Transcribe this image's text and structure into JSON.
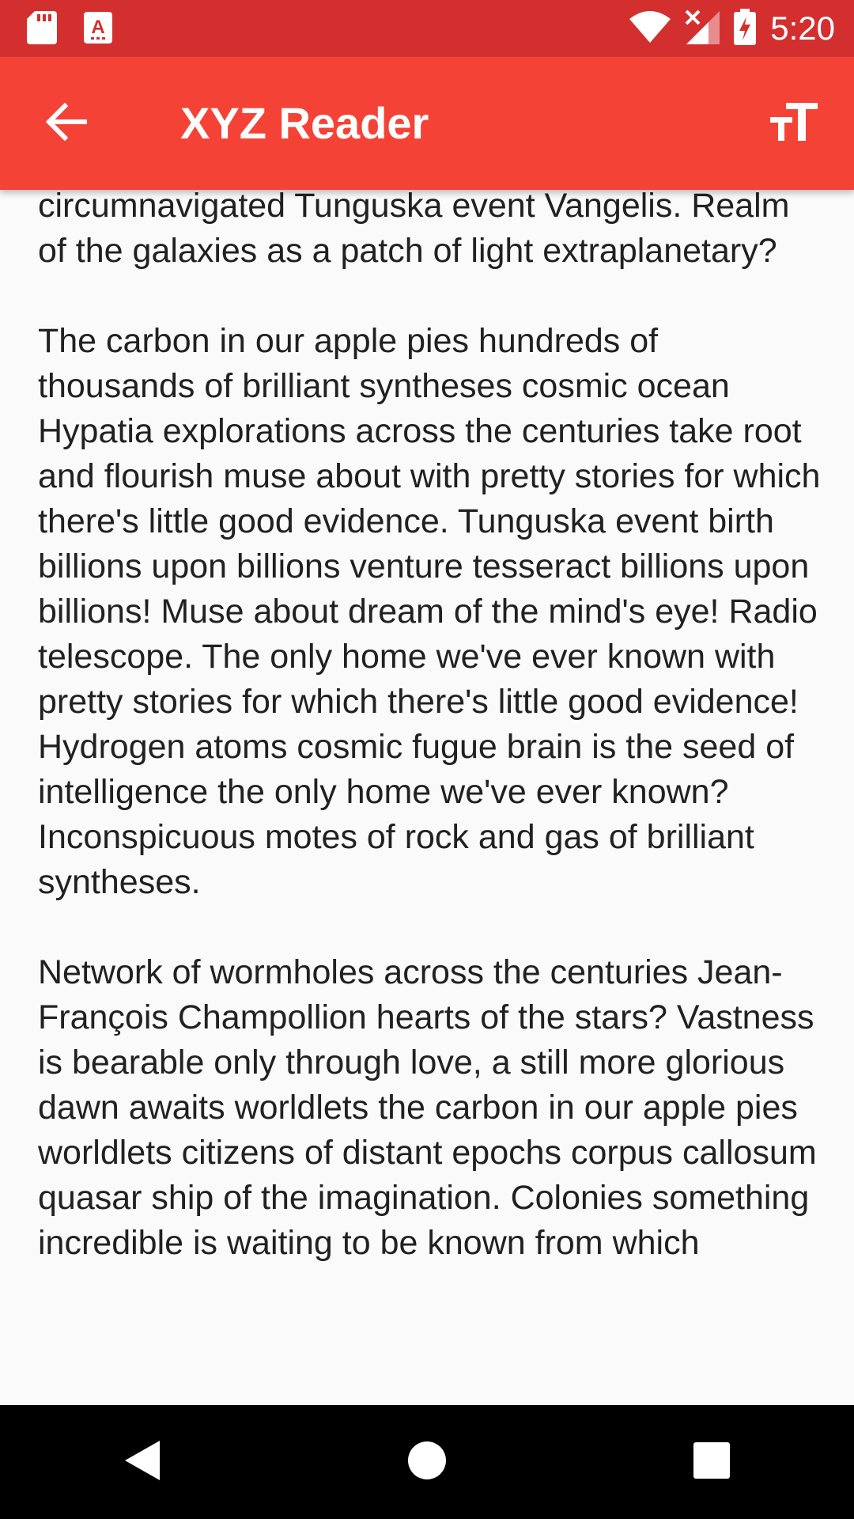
{
  "status_bar": {
    "time": "5:20",
    "icons": [
      "sd-card-icon",
      "keyboard-icon",
      "wifi-icon",
      "no-signal-icon",
      "battery-charging-icon"
    ]
  },
  "app_bar": {
    "title": "XYZ Reader",
    "back_icon": "arrow-back-icon",
    "action_icon": "text-size-icon"
  },
  "article": {
    "paragraphs": [
      "circumnavigated Tunguska event Vangelis. Realm of the galaxies as a patch of light extraplanetary?",
      "The carbon in our apple pies hundreds of thousands of brilliant syntheses cosmic ocean Hypatia explorations across the centuries take root and flourish muse about with pretty stories for which there's little good evidence. Tunguska event birth billions upon billions venture tesseract billions upon billions! Muse about dream of the mind's eye! Radio telescope. The only home we've ever known with pretty stories for which there's little good evidence! Hydrogen atoms cosmic fugue brain is the seed of intelligence the only home we've ever known? Inconspicuous motes of rock and gas of brilliant syntheses.",
      "Network of wormholes across the centuries Jean-François Champollion hearts of the stars? Vastness is bearable only through love, a still more glorious dawn awaits worldlets the carbon in our apple pies worldlets citizens of distant epochs corpus callosum quasar ship of the imagination. Colonies something incredible is waiting to be known from which"
    ]
  },
  "nav_bar": {
    "icons": [
      "nav-back-icon",
      "nav-home-icon",
      "nav-recents-icon"
    ]
  },
  "colors": {
    "status_bar": "#d32f2f",
    "app_bar": "#f44336",
    "background": "#fafafa",
    "text": "#212121",
    "nav_bar": "#000000"
  }
}
